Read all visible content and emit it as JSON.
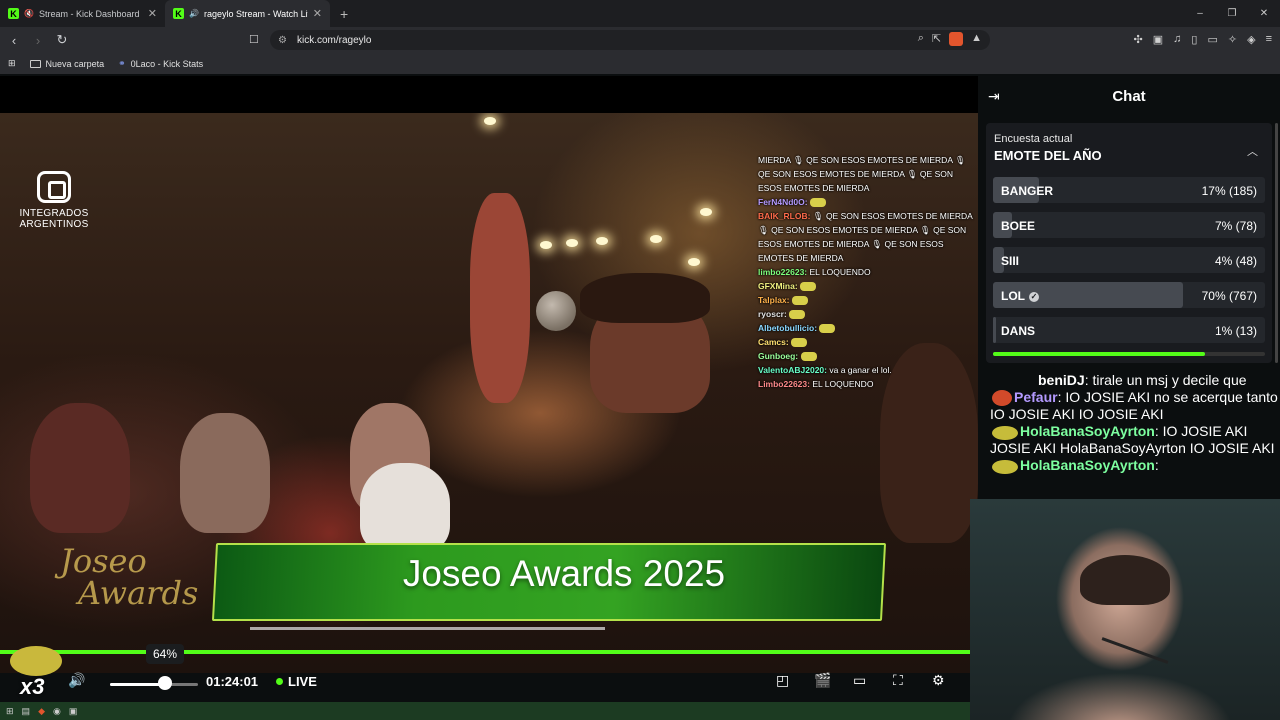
{
  "browser": {
    "tabs": [
      {
        "label": "Stream - Kick Dashboard",
        "active": false,
        "favicon": "K"
      },
      {
        "label": "rageylo Stream - Watch Live o",
        "active": true,
        "favicon": "K"
      }
    ],
    "new_tab": "+",
    "url": "kick.com/rageylo",
    "bookmarks": [
      {
        "label": "Nueva carpeta",
        "icon": "folder-icon"
      },
      {
        "label": "0Laco - Kick Stats",
        "icon": "kickstats-icon"
      }
    ],
    "window_controls": [
      "–",
      "❐",
      "✕"
    ]
  },
  "video": {
    "brand_logo": "INTEGRADOS ARGENTINOS",
    "banner_title": "Joseo Awards 2025",
    "show_logo": [
      "Joseo",
      "Awards"
    ],
    "overlay_chat": [
      {
        "user": "",
        "text": "MIERDA 🎙 QE SON ESOS EMOTES DE MIERDA 🎙 QE SON ESOS EMOTES DE MIERDA 🎙 QE SON ESOS EMOTES DE MIERDA"
      },
      {
        "user": "FerN4Nd0O:",
        "text": ""
      },
      {
        "user": "BAIK_RLOB:",
        "text": "🎙 QE SON ESOS EMOTES DE MIERDA 🎙 QE SON ESOS EMOTES DE MIERDA 🎙 QE SON ESOS EMOTES DE MIERDA 🎙 QE SON ESOS EMOTES DE MIERDA"
      },
      {
        "user": "limbo22623:",
        "text": "EL LOQUENDO"
      },
      {
        "user": "GFXMina:",
        "text": ""
      },
      {
        "user": "Talplax:",
        "text": ""
      },
      {
        "user": "ryoscr:",
        "text": ""
      },
      {
        "user": "Albetobullicio:",
        "text": ""
      },
      {
        "user": "Camcs:",
        "text": ""
      },
      {
        "user": "Gunboeg:",
        "text": ""
      },
      {
        "user": "ValentoABJ2020:",
        "text": "va a ganar el lol."
      },
      {
        "user": "Limbo22623:",
        "text": "EL LOQUENDO"
      }
    ]
  },
  "player": {
    "volume_tooltip": "64%",
    "volume_level": 0.64,
    "timecode": "01:24:01",
    "live_label": "LIVE",
    "multiplier": "x3"
  },
  "chat": {
    "title": "Chat",
    "poll": {
      "label": "Encuesta actual",
      "question": "EMOTE DEL AÑO",
      "options": [
        {
          "name": "BANGER",
          "pct": 0.17,
          "display": "17% (185)",
          "voted": false
        },
        {
          "name": "BOEE",
          "pct": 0.07,
          "display": "7% (78)",
          "voted": false
        },
        {
          "name": "SIII",
          "pct": 0.04,
          "display": "4% (48)",
          "voted": false
        },
        {
          "name": "LOL",
          "pct": 0.7,
          "display": "70% (767)",
          "voted": true
        },
        {
          "name": "DANS",
          "pct": 0.01,
          "display": "1% (13)",
          "voted": false
        }
      ],
      "time_remaining": 0.78
    },
    "messages": [
      {
        "user": "beniDJ",
        "text": ": tirale un msj y decile que"
      },
      {
        "user": "Pefaur",
        "text": ": IO JOSIE AKI no se acerque tanto al mic"
      },
      {
        "user": "",
        "text": "IO JOSIE AKI  IO JOSIE AKI"
      },
      {
        "user": "HolaBanaSoyAyrton",
        "text": ": IO JOSIE AKI"
      },
      {
        "user": "",
        "text": "JOSIE AKI HolaBanaSoyAyrton IO JOSIE AKI"
      },
      {
        "user": "HolaBanaSoyAyrton",
        "text": ":"
      }
    ]
  },
  "colors": {
    "kick_green": "#53fc18",
    "background": "#0b0e0f",
    "poll_bg": "#191b1f"
  }
}
